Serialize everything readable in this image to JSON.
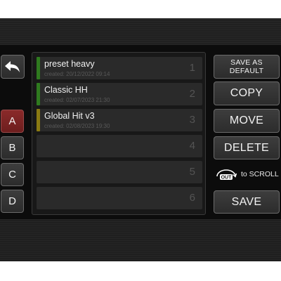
{
  "colors": {
    "background": "#0c0c0c",
    "slot": "#2a2a2a",
    "active_letter": "#7a2424",
    "bar_green": "#2f7a1f",
    "bar_yellow": "#8a7a12"
  },
  "navigation": {
    "back_icon": "back-arrow-icon",
    "banks": [
      {
        "label": "A",
        "active": true
      },
      {
        "label": "B",
        "active": false
      },
      {
        "label": "C",
        "active": false
      },
      {
        "label": "D",
        "active": false
      }
    ]
  },
  "presets": [
    {
      "number": "1",
      "name": "preset heavy",
      "created": "created: 20/12/2022 09:14",
      "color": "#2f7a1f"
    },
    {
      "number": "2",
      "name": "Classic HH",
      "created": "created: 02/07/2023 21:30",
      "color": "#2f7a1f"
    },
    {
      "number": "3",
      "name": "Global Hit v3",
      "created": "created: 02/08/2023 19:30",
      "color": "#8a7a12"
    },
    {
      "number": "4",
      "name": "",
      "created": "",
      "color": ""
    },
    {
      "number": "5",
      "name": "",
      "created": "",
      "color": ""
    },
    {
      "number": "6",
      "name": "",
      "created": "",
      "color": ""
    }
  ],
  "actions": {
    "save_as_default_line1": "SAVE AS",
    "save_as_default_line2": "DEFAULT",
    "copy": "COPY",
    "move": "MOVE",
    "delete": "DELETE",
    "scroll_knob": "OUT",
    "scroll_hint": "to SCROLL",
    "save": "SAVE"
  }
}
